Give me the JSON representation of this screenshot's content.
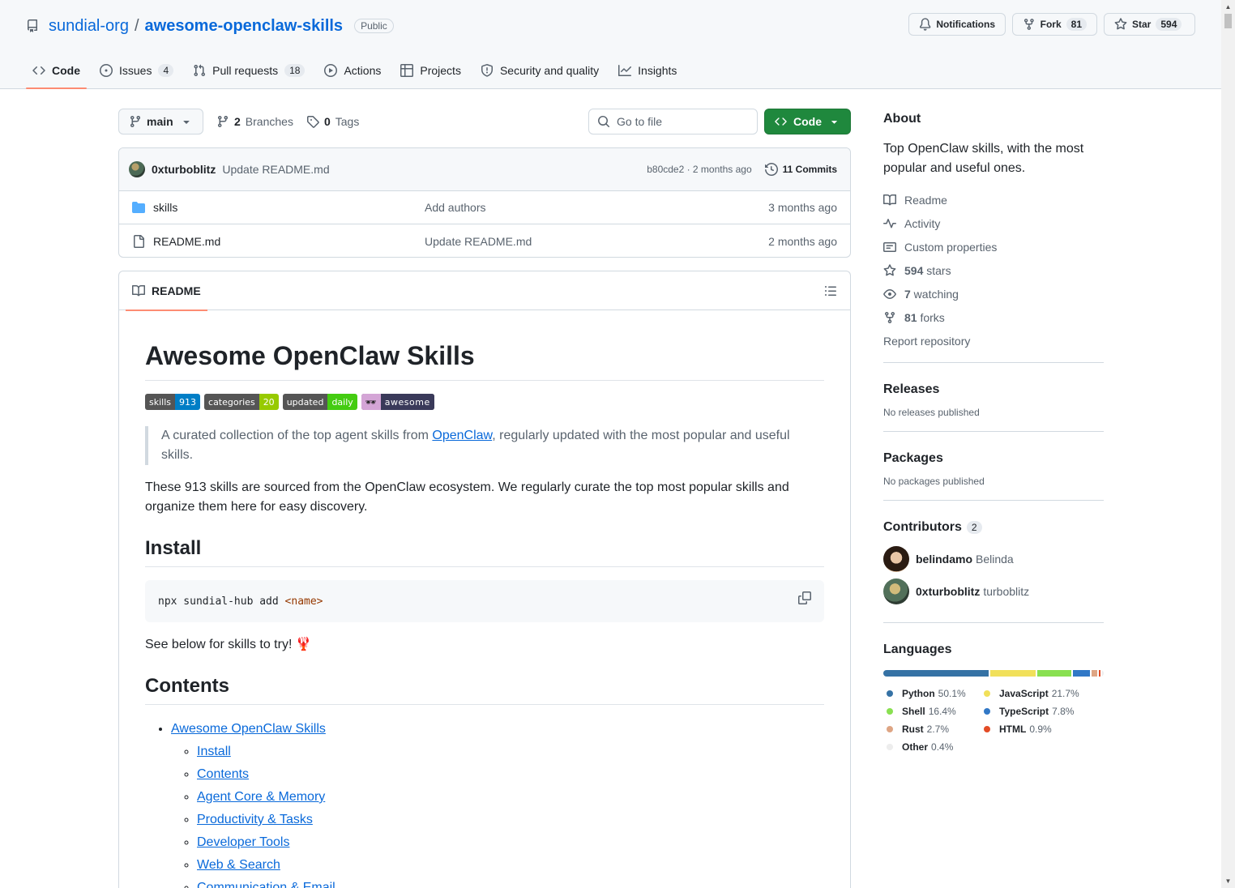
{
  "repo": {
    "owner": "sundial-org",
    "separator": "/",
    "name": "awesome-openclaw-skills",
    "visibility": "Public"
  },
  "header_actions": {
    "notifications": "Notifications",
    "fork_label": "Fork",
    "fork_count": "81",
    "star_label": "Star",
    "star_count": "594"
  },
  "nav": [
    {
      "label": "Code",
      "icon": "code-icon",
      "active": true
    },
    {
      "label": "Issues",
      "icon": "issue-icon",
      "count": "4"
    },
    {
      "label": "Pull requests",
      "icon": "pull-request-icon",
      "count": "18"
    },
    {
      "label": "Actions",
      "icon": "play-icon"
    },
    {
      "label": "Projects",
      "icon": "table-icon"
    },
    {
      "label": "Security and quality",
      "icon": "shield-icon"
    },
    {
      "label": "Insights",
      "icon": "graph-icon"
    }
  ],
  "toolbar": {
    "branch": "main",
    "branches_count": "2",
    "branches_label": "Branches",
    "tags_count": "0",
    "tags_label": "Tags",
    "goto_placeholder": "Go to file",
    "code_label": "Code"
  },
  "commit": {
    "author": "0xturboblitz",
    "message": "Update README.md",
    "sha_time": "b80cde2 · 2 months ago",
    "commits_label": "11 Commits"
  },
  "files": [
    {
      "name": "skills",
      "type": "folder",
      "message": "Add authors",
      "date": "3 months ago"
    },
    {
      "name": "README.md",
      "type": "file",
      "message": "Update README.md",
      "date": "2 months ago"
    }
  ],
  "readme": {
    "tab_label": "README",
    "title": "Awesome OpenClaw Skills",
    "badges": {
      "skills_l": "skills",
      "skills_r": "913",
      "categories_l": "categories",
      "categories_r": "20",
      "updated_l": "updated",
      "updated_r": "daily",
      "awesome_l": "🕶",
      "awesome_r": "awesome"
    },
    "quote_pre": "A curated collection of the top agent skills from ",
    "quote_link": "OpenClaw",
    "quote_post": ", regularly updated with the most popular and useful skills.",
    "intro": "These 913 skills are sourced from the OpenClaw ecosystem. We regularly curate the top most popular skills and organize them here for easy discovery.",
    "install_heading": "Install",
    "code_cmd": "npx sundial-hub add ",
    "code_tag": "<name>",
    "see_below": "See below for skills to try! 🦞",
    "contents_heading": "Contents",
    "toc_root": "Awesome OpenClaw Skills",
    "toc": [
      "Install",
      "Contents",
      "Agent Core & Memory",
      "Productivity & Tasks",
      "Developer Tools",
      "Web & Search",
      "Communication & Email"
    ]
  },
  "sidebar": {
    "about_heading": "About",
    "description": "Top OpenClaw skills, with the most popular and useful ones.",
    "items": [
      {
        "icon": "book-icon",
        "label": "Readme"
      },
      {
        "icon": "pulse-icon",
        "label": "Activity"
      },
      {
        "icon": "note-icon",
        "label": "Custom properties"
      },
      {
        "icon": "star-icon",
        "bold": "594",
        "label": " stars"
      },
      {
        "icon": "eye-icon",
        "bold": "7",
        "label": " watching"
      },
      {
        "icon": "fork-icon",
        "bold": "81",
        "label": " forks"
      }
    ],
    "report": "Report repository",
    "releases_heading": "Releases",
    "releases_text": "No releases published",
    "packages_heading": "Packages",
    "packages_text": "No packages published",
    "contributors_heading": "Contributors",
    "contributors_count": "2",
    "contributors": [
      {
        "login": "belindamo",
        "name": "Belinda"
      },
      {
        "login": "0xturboblitz",
        "name": "turboblitz"
      }
    ],
    "languages_heading": "Languages",
    "languages": [
      {
        "name": "Python",
        "pct": "50.1%",
        "value": 50.1,
        "color": "#3572A5"
      },
      {
        "name": "JavaScript",
        "pct": "21.7%",
        "value": 21.7,
        "color": "#f1e05a"
      },
      {
        "name": "Shell",
        "pct": "16.4%",
        "value": 16.4,
        "color": "#89e051"
      },
      {
        "name": "TypeScript",
        "pct": "7.8%",
        "value": 7.8,
        "color": "#3178c6"
      },
      {
        "name": "Rust",
        "pct": "2.7%",
        "value": 2.7,
        "color": "#dea584"
      },
      {
        "name": "HTML",
        "pct": "0.9%",
        "value": 0.9,
        "color": "#e34c26"
      },
      {
        "name": "Other",
        "pct": "0.4%",
        "value": 0.4,
        "color": "#ededed"
      }
    ]
  }
}
